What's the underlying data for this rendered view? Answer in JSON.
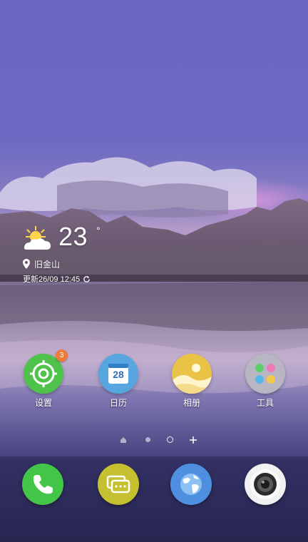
{
  "weather": {
    "temperature": "23",
    "degree_symbol": "°",
    "location": "旧金山",
    "updated": "更新26/09 12:45"
  },
  "apps": [
    {
      "label": "设置",
      "icon": "settings-gear-icon",
      "badge": "3",
      "color": "#4ec24a"
    },
    {
      "label": "日历",
      "icon": "calendar-icon",
      "date": "28",
      "color": "#58a6e0"
    },
    {
      "label": "相册",
      "icon": "gallery-icon",
      "color": "#e8c346"
    },
    {
      "label": "工具",
      "icon": "tools-folder-icon",
      "color": "#b9b6c4"
    }
  ],
  "dock": [
    {
      "icon": "phone-icon",
      "color": "#43c548"
    },
    {
      "icon": "messages-icon",
      "color": "#c5c02f"
    },
    {
      "icon": "browser-globe-icon",
      "color": "#4f8fe0"
    },
    {
      "icon": "camera-icon",
      "color": "#f1f1f1"
    }
  ],
  "pager": {
    "pages": 3,
    "current": 1,
    "indicators": [
      "home",
      "page",
      "current-page",
      "add-page"
    ]
  }
}
